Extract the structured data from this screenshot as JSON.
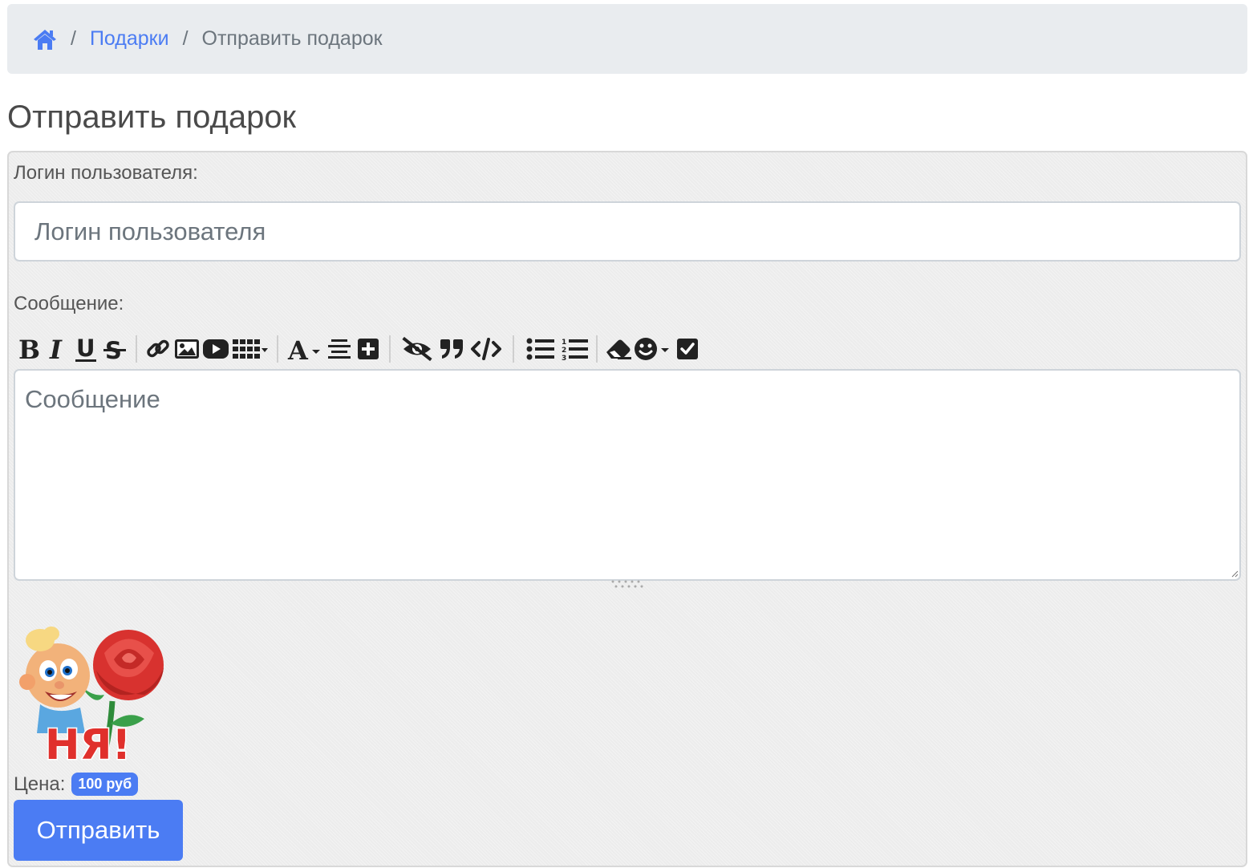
{
  "breadcrumb": {
    "home_icon": "home-icon",
    "separator": "/",
    "link": "Подарки",
    "current": "Отправить подарок"
  },
  "page": {
    "title": "Отправить подарок"
  },
  "form": {
    "login_label": "Логин пользователя:",
    "login_placeholder": "Логин пользователя",
    "message_label": "Сообщение:",
    "message_placeholder": "Сообщение",
    "toolbar_icons": [
      [
        "bold-icon",
        "italic-icon",
        "underline-icon",
        "strikethrough-icon"
      ],
      [
        "link-icon",
        "image-icon",
        "youtube-icon",
        "table-icon"
      ],
      [
        "font-color-icon",
        "align-center-icon",
        "spoiler-plus-icon"
      ],
      [
        "hide-icon",
        "quote-icon",
        "code-icon"
      ],
      [
        "bullet-list-icon",
        "numbered-list-icon"
      ],
      [
        "eraser-icon",
        "smiley-icon",
        "checkbox-icon"
      ]
    ],
    "gift_image": "gift-rose-nya-image",
    "gift_caption": "НЯ!",
    "price_label": "Цена:",
    "price_value": "100 руб",
    "submit_label": "Отправить"
  },
  "colors": {
    "accent": "#4b7cf3",
    "breadcrumb_bg": "#e9ecef",
    "form_bg": "#ececec"
  }
}
